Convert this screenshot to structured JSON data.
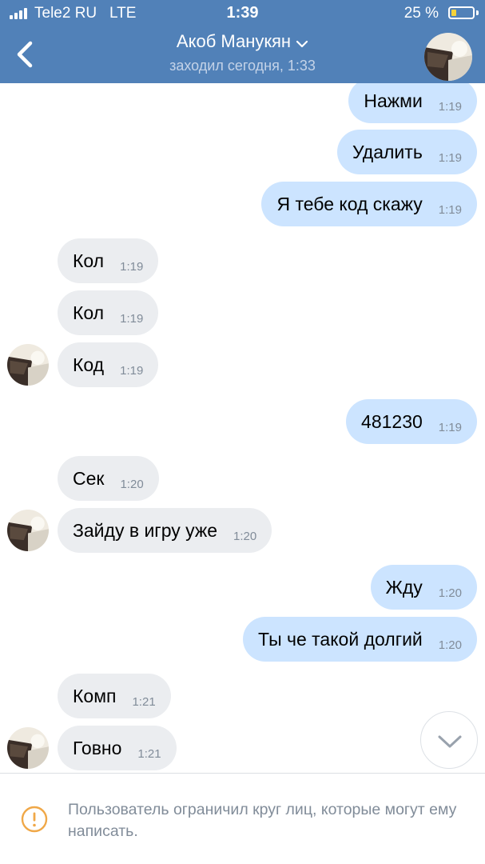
{
  "status_bar": {
    "carrier": "Tele2 RU",
    "network": "LTE",
    "time": "1:39",
    "battery_text": "25 %",
    "battery_level": 0.25,
    "signal_bars": 4
  },
  "header": {
    "back_icon": "chevron-left-icon",
    "title": "Акоб Манукян",
    "title_dropdown_icon": "chevron-down-icon",
    "subtitle": "заходил сегодня, 1:33"
  },
  "messages": [
    {
      "dir": "out",
      "text": "Нажми",
      "time": "1:19"
    },
    {
      "dir": "out",
      "text": "Удалить",
      "time": "1:19"
    },
    {
      "dir": "out",
      "text": "Я тебе код скажу",
      "time": "1:19"
    },
    {
      "dir": "in",
      "text": "Кол",
      "time": "1:19"
    },
    {
      "dir": "in",
      "text": "Кол",
      "time": "1:19"
    },
    {
      "dir": "in",
      "text": "Код",
      "time": "1:19"
    },
    {
      "dir": "out",
      "text": "481230",
      "time": "1:19"
    },
    {
      "dir": "in",
      "text": "Сек",
      "time": "1:20"
    },
    {
      "dir": "in",
      "text": "Зайду в игру уже",
      "time": "1:20"
    },
    {
      "dir": "out",
      "text": "Жду",
      "time": "1:20"
    },
    {
      "dir": "out",
      "text": "Ты че такой долгий",
      "time": "1:20"
    },
    {
      "dir": "in",
      "text": "Комп",
      "time": "1:21"
    },
    {
      "dir": "in",
      "text": "Говно",
      "time": "1:21"
    }
  ],
  "scroll_down_icon": "chevron-down-icon",
  "footer": {
    "warning_icon": "warning-circle-icon",
    "restriction_text": "Пользователь ограничил круг лиц, которые могут ему написать."
  },
  "colors": {
    "header_bg": "#5181b8",
    "outgoing_bubble": "#cce4ff",
    "incoming_bubble": "#ebedf0",
    "meta_text": "#818c99",
    "warning": "#f0a848"
  }
}
